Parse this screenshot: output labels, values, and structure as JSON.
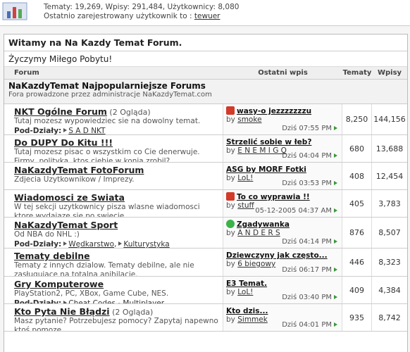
{
  "stats": {
    "line1": "Tematy: 19,269, Wpisy: 291,484, Użytkownicy: 8,080",
    "line2_prefix": "Ostatnio zarejestrowany użytkownik to : ",
    "newest_user": "tewuer"
  },
  "welcome": "Witamy na Na Kazdy Temat Forum.",
  "greeting": "Życzymy Miłego Pobytu!",
  "columns": {
    "forum": "Forum",
    "last_post": "Ostatni wpis",
    "topics": "Tematy",
    "posts": "Wpisy"
  },
  "category": {
    "title": "NaKazdyTemat Najpopularniejsze Forums",
    "desc": "Fora prowadzone przez administracje NaKazdyTemat.com"
  },
  "subforums_label": "Pod-Działy:",
  "forums": [
    {
      "title": "NKT Ogólne Forum",
      "views": "(2 Ogląda)",
      "desc": "Tutaj mozesz wypowiedziec sie na dowolny temat.",
      "sub": [
        "S A D NKT"
      ],
      "lp_title": "wasy-o jezzzzzzzu",
      "lp_icon": "thumb-down-icon",
      "lp_by": "smoke",
      "lp_date": "Dziś 07:55 PM",
      "topics": "8,250",
      "posts": "144,156"
    },
    {
      "title": "Do DUPY Do Kitu !!!",
      "views": "",
      "desc": "Tutaj mozesz pisac o wszystkim co Cie denerwuje. Firmy, polityka, ktos ciebie w konia zrobil?",
      "sub": [],
      "lp_title": "Strzelić sobie w łeb?",
      "lp_icon": "",
      "lp_by": "E N E M I G O",
      "lp_date": "Dziś 04:04 PM",
      "topics": "680",
      "posts": "13,688"
    },
    {
      "title": "NaKazdyTemat FotoForum",
      "views": "",
      "desc": "Zdjecia Uzytkownikow / Imprezy.",
      "sub": [],
      "lp_title": "ASG by MORF Fotki",
      "lp_icon": "",
      "lp_by": "LoL!",
      "lp_date": "Dziś 03:53 PM",
      "topics": "408",
      "posts": "12,454"
    },
    {
      "title": "Wiadomosci ze Swiata",
      "views": "",
      "desc": "W tej sekcji uzytkownicy pisza wlasne wiadomosci ktore wydajaze sie po swiecie.",
      "sub": [],
      "lp_title": "To co wyprawia !!",
      "lp_icon": "thumb-down-icon",
      "lp_by": "stuff",
      "lp_date": "05-12-2005 04:37 AM",
      "topics": "405",
      "posts": "3,783"
    },
    {
      "title": "NaKazdyTemat Sport",
      "views": "",
      "desc": "Od NBA do NHL :)",
      "sub": [
        "Wędkarstwo",
        "Kulturystyka"
      ],
      "lp_title": "Zgadywanka",
      "lp_icon": "smiley-icon",
      "lp_by": "A N D E R S",
      "lp_date": "Dziś 04:14 PM",
      "topics": "876",
      "posts": "8,507"
    },
    {
      "title": "Tematy debilne",
      "views": "",
      "desc": "Tematy z innych dzialow. Tematy debilne, ale nie zasługujace na totalna anihilacje.",
      "sub": [],
      "lp_title": "Dziewczyny jak często...",
      "lp_icon": "",
      "lp_by": "6 biegowy",
      "lp_date": "Dziś 06:17 PM",
      "topics": "446",
      "posts": "8,323"
    },
    {
      "title": "Gry Komputerowe",
      "views": "",
      "desc": "PlayStation2, PC, XBox, Game Cube, NES.",
      "sub": [
        "Cheat Codes - Multiplayer"
      ],
      "lp_title": "E3 Temat.",
      "lp_icon": "",
      "lp_by": "LoL!",
      "lp_date": "Dziś 03:40 PM",
      "topics": "409",
      "posts": "4,384"
    },
    {
      "title": "Kto Pyta Nie Błądzi",
      "views": "(2 Ogląda)",
      "desc": "Masz pytanie? Potrzebujesz pomocy? Zapytaj napewno ktoś pomoze.",
      "sub": [],
      "lp_title": "Kto dzis...",
      "lp_icon": "",
      "lp_by": "Simmek",
      "lp_date": "Dziś 04:01 PM",
      "topics": "935",
      "posts": "8,742"
    }
  ],
  "by_label": "by",
  "colors": {
    "border": "#cccccc",
    "header_bg": "#efefef",
    "thumb_down": "#d23a2a",
    "smiley": "#3bb34a"
  }
}
